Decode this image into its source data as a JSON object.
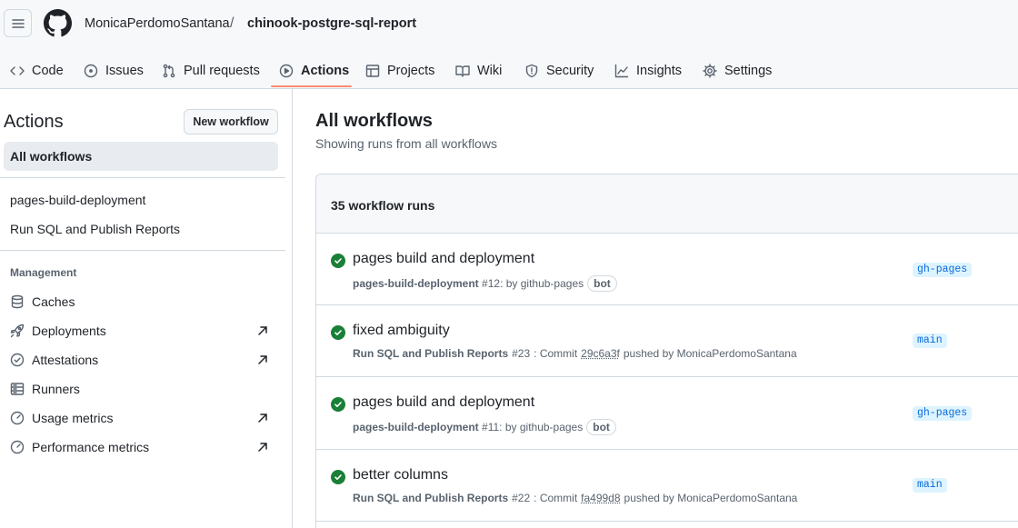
{
  "header": {
    "owner": "MonicaPerdomoSantana",
    "separator": "/",
    "repo": "chinook-postgre-sql-report"
  },
  "tabs": [
    {
      "label": "Code",
      "icon": "code-icon"
    },
    {
      "label": "Issues",
      "icon": "issue-icon"
    },
    {
      "label": "Pull requests",
      "icon": "pull-request-icon"
    },
    {
      "label": "Actions",
      "icon": "play-icon",
      "active": true
    },
    {
      "label": "Projects",
      "icon": "table-icon"
    },
    {
      "label": "Wiki",
      "icon": "book-icon"
    },
    {
      "label": "Security",
      "icon": "shield-icon"
    },
    {
      "label": "Insights",
      "icon": "graph-icon"
    },
    {
      "label": "Settings",
      "icon": "gear-icon"
    }
  ],
  "sidebar": {
    "title": "Actions",
    "new_workflow": "New workflow",
    "all_workflows": "All workflows",
    "workflows": [
      "pages-build-deployment",
      "Run SQL and Publish Reports"
    ],
    "management_heading": "Management",
    "management": [
      {
        "label": "Caches",
        "icon": "cache-icon",
        "external": false
      },
      {
        "label": "Deployments",
        "icon": "rocket-icon",
        "external": true
      },
      {
        "label": "Attestations",
        "icon": "verified-icon",
        "external": true
      },
      {
        "label": "Runners",
        "icon": "server-icon",
        "external": false
      },
      {
        "label": "Usage metrics",
        "icon": "meter-icon",
        "external": true
      },
      {
        "label": "Performance metrics",
        "icon": "meter-icon",
        "external": true
      }
    ]
  },
  "main": {
    "title": "All workflows",
    "subtitle": "Showing runs from all workflows",
    "runs_count": "35 workflow runs",
    "runs": [
      {
        "title": "pages build and deployment",
        "workflow": "pages-build-deployment",
        "number": "#12",
        "trigger_prefix": ": by github-pages",
        "sha": "",
        "trigger_suffix": "",
        "bot": "bot",
        "branch": "gh-pages",
        "status": "success"
      },
      {
        "title": "fixed ambiguity",
        "workflow": "Run SQL and Publish Reports",
        "number": "#23",
        "trigger_prefix": ": Commit",
        "sha": "29c6a3f",
        "trigger_suffix": "pushed by MonicaPerdomoSantana",
        "bot": "",
        "branch": "main",
        "status": "success"
      },
      {
        "title": "pages build and deployment",
        "workflow": "pages-build-deployment",
        "number": "#11",
        "trigger_prefix": ": by github-pages",
        "sha": "",
        "trigger_suffix": "",
        "bot": "bot",
        "branch": "gh-pages",
        "status": "success"
      },
      {
        "title": "better columns",
        "workflow": "Run SQL and Publish Reports",
        "number": "#22",
        "trigger_prefix": ": Commit",
        "sha": "fa499d8",
        "trigger_suffix": "pushed by MonicaPerdomoSantana",
        "bot": "",
        "branch": "main",
        "status": "success"
      }
    ]
  },
  "colors": {
    "success": "#1a7f37",
    "tab_underline": "#fd8c73",
    "branch_bg": "#ddf4ff",
    "branch_fg": "#0969da"
  }
}
